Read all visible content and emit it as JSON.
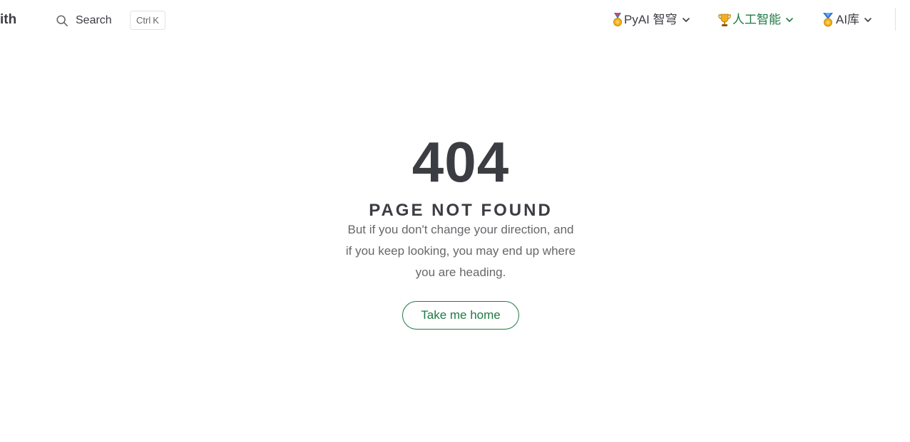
{
  "header": {
    "site_title": "ith",
    "search": {
      "label": "Search",
      "icon": "search-icon"
    },
    "shortcut": {
      "ctrl": "Ctrl",
      "key": "K"
    },
    "menus": [
      {
        "label": "PyAI 智穹",
        "icon": "medal-icon",
        "active": false
      },
      {
        "label": "人工智能",
        "icon": "trophy-icon",
        "active": true
      },
      {
        "label": "AI库",
        "icon": "medal-icon",
        "active": false
      }
    ]
  },
  "error": {
    "code": "404",
    "title": "PAGE NOT FOUND",
    "quote": "But if you don't change your direction, and if you keep looking, you may end up where you are heading.",
    "home_link": "Take me home"
  },
  "colors": {
    "text": "#3c3c43",
    "muted": "#67676c",
    "brand": "#1f7a44",
    "border": "#e2e2e3"
  }
}
